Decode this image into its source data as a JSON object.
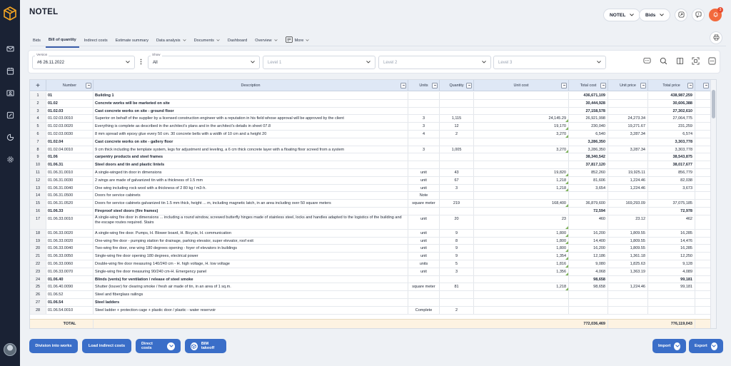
{
  "app": {
    "title": "NOTEL"
  },
  "header": {
    "project": "NOTEL",
    "mode": "Bids",
    "notifications": "3"
  },
  "tabs": [
    {
      "label": "Bids"
    },
    {
      "label": "Bill of quantity"
    },
    {
      "label": "Indirect costs"
    },
    {
      "label": "Estimate summary"
    },
    {
      "label": "Data analysis"
    },
    {
      "label": "Documents"
    },
    {
      "label": "Dashboard"
    },
    {
      "label": "Overview"
    },
    {
      "label": "More"
    }
  ],
  "filters": {
    "version_label": "Version",
    "version_value": "#6 26.11.2022",
    "show_label": "Show",
    "show_value": "All",
    "level1": "Level 1",
    "level2": "Level 2",
    "level3": "Level 3"
  },
  "table": {
    "headers": {
      "number": "Number",
      "description": "Description",
      "units": "Units",
      "quantity": "Quantity",
      "unit_cost": "Unit cost",
      "total_cost": "Total cost",
      "unit_price": "Unit price",
      "total_price": "Total price"
    },
    "rows": [
      {
        "idx": "1",
        "num": "01",
        "desc": "Building 1",
        "units": "",
        "qty": "",
        "uc": "",
        "tc": "436,671,109",
        "up": "",
        "tp": "438,987,259",
        "bold": true
      },
      {
        "idx": "2",
        "num": "01.02",
        "desc": "Concrete works will be marketed on site",
        "units": "",
        "qty": "",
        "uc": "",
        "tc": "30,444,928",
        "up": "",
        "tp": "30,606,388",
        "bold": true
      },
      {
        "idx": "3",
        "num": "01.02.03",
        "desc": "Cast concrete works on site - ground floor",
        "units": "",
        "qty": "",
        "uc": "",
        "tc": "27,158,578",
        "up": "",
        "tp": "27,302,610",
        "bold": true
      },
      {
        "idx": "4",
        "num": "01.02.03.0010",
        "desc": "Superior on behalf of the supplier by a licensed construction engineer with a reputation in his field whose approval will be approved by the client",
        "units": "3",
        "qty": "1,115",
        "uc": "24,145.29",
        "tc": "26,921,998",
        "up": "24,273.34",
        "tp": "27,064,775",
        "bold": false
      },
      {
        "idx": "5",
        "num": "01.02.03.0020",
        "desc": "Everything is complete as described in the architect's plans and in the architect's details in sheet 07.8",
        "units": "3",
        "qty": "12",
        "uc": "19,170",
        "tc": "230,040",
        "up": "19,271.67",
        "tp": "231,259",
        "bold": false
      },
      {
        "idx": "6",
        "num": "01.02.03.0030",
        "desc": "8 mm spread with epoxy glue every 50 cm. 30 concrete belts with a width of 10 cm and a height 20",
        "units": "4",
        "qty": "2",
        "uc": "3,270",
        "tc": "6,540",
        "up": "3,287.34",
        "tp": "6,574",
        "bold": false
      },
      {
        "idx": "7",
        "num": "01.02.04",
        "desc": "Cast concrete works on site - gallery floor",
        "units": "",
        "qty": "",
        "uc": "",
        "tc": "3,286,350",
        "up": "",
        "tp": "3,303,778",
        "bold": true
      },
      {
        "idx": "8",
        "num": "01.02.04.0010",
        "desc": "9 cm thick including the template system, legs for adjustment and leveling, a 6 cm thick concrete layer with a floating floor screed from a system",
        "units": "3",
        "qty": "1,005",
        "uc": "3,270",
        "tc": "3,286,350",
        "up": "3,287.34",
        "tp": "3,303,778",
        "bold": false
      },
      {
        "idx": "9",
        "num": "01.06",
        "desc": "carpentry products and steel frames",
        "units": "",
        "qty": "",
        "uc": "",
        "tc": "38,340,542",
        "up": "",
        "tp": "38,543,875",
        "bold": true
      },
      {
        "idx": "10",
        "num": "01.06.31",
        "desc": "Steel doors and tin and plastic lintels",
        "units": "",
        "qty": "",
        "uc": "",
        "tc": "37,817,120",
        "up": "",
        "tp": "38,017,677",
        "bold": true
      },
      {
        "idx": "11",
        "num": "01.06.31.0010",
        "desc": "A single-winged tin door in dimensions",
        "units": "unit",
        "qty": "43",
        "uc": "19,820",
        "tc": "852,260",
        "up": "19,925.11",
        "tp": "856,779",
        "bold": false
      },
      {
        "idx": "12",
        "num": "01.06.31.0030",
        "desc": "2 wings are made of galvanized tin with a thickness of 1.5 mm",
        "units": "unit",
        "qty": "67",
        "uc": "1,218",
        "tc": "81,606",
        "up": "1,224.46",
        "tp": "82,038",
        "bold": false
      },
      {
        "idx": "13",
        "num": "01.06.31.0040",
        "desc": "One wing including rock wool with a thickness of 2 80 kg / m3-h.",
        "units": "unit",
        "qty": "3",
        "uc": "1,218",
        "tc": "3,654",
        "up": "1,224.46",
        "tp": "3,673",
        "bold": false
      },
      {
        "idx": "14",
        "num": "01.06.31.0500",
        "desc": "Doors for service cabinets",
        "units": "Note",
        "qty": "",
        "uc": "",
        "tc": "",
        "up": "",
        "tp": "",
        "bold": false
      },
      {
        "idx": "15",
        "num": "01.06.31.0520",
        "desc": "Doors for service cabinets galvanized tin 1.5 mm thick, height ... m, including magnetic latch, in an area including over 50 square meters",
        "units": "square meter",
        "qty": "219",
        "uc": "168,400",
        "tc": "36,879,600",
        "up": "169,293.09",
        "tp": "37,075,185",
        "bold": false
      },
      {
        "idx": "16",
        "num": "01.06.33",
        "desc": "Fireproof steel doors (fire frames)",
        "units": "",
        "qty": "",
        "uc": "",
        "tc": "72,594",
        "up": "",
        "tp": "72,978",
        "bold": true
      },
      {
        "idx": "17",
        "num": "01.06.33.0010",
        "desc": "A single-wing fire door in dimensions ... including a round window, screwed butterfly hinges made of stainless steel, locks and handles adapted to the logistics of the building and the escape routes required. Stairs",
        "units": "unit",
        "qty": "20",
        "uc": "23",
        "tc": "460",
        "up": "23.12",
        "tp": "462",
        "bold": false,
        "tall": true
      },
      {
        "idx": "18",
        "num": "01.06.33.0020",
        "desc": "A single-wing fire door. Pumps, H. Blower board, H. Bicycle, H. communication",
        "units": "unit",
        "qty": "9",
        "uc": "1,800",
        "tc": "16,200",
        "up": "1,809.55",
        "tp": "16,285",
        "bold": false
      },
      {
        "idx": "19",
        "num": "01.06.33.0020",
        "desc": "One-wing fire door - pumping station for drainage, parking elevator, super elevator, roof exit",
        "units": "unit",
        "qty": "8",
        "uc": "1,800",
        "tc": "14,400",
        "up": "1,809.55",
        "tp": "14,476",
        "bold": false
      },
      {
        "idx": "20",
        "num": "01.06.33.0040",
        "desc": "Two-wing fire door, one wing 180 degrees opening - foyer of elevators in buildings",
        "units": "unit",
        "qty": "9",
        "uc": "1,800",
        "tc": "16,200",
        "up": "1,809.55",
        "tp": "16,285",
        "bold": false
      },
      {
        "idx": "21",
        "num": "01.06.33.0050",
        "desc": "Single-wing fire door opening 180 degrees, electrical power",
        "units": "unit",
        "qty": "9",
        "uc": "1,354",
        "tc": "12,186",
        "up": "1,361.18",
        "tp": "12,250",
        "bold": false
      },
      {
        "idx": "22",
        "num": "01.06.33.0060",
        "desc": "Double-wing fire door measuring 140/240 cm - H. high voltage, H. low voltage",
        "units": "units",
        "qty": "5",
        "uc": "1,816",
        "tc": "9,080",
        "up": "1,825.63",
        "tp": "9,128",
        "bold": false
      },
      {
        "idx": "23",
        "num": "01.06.33.0070",
        "desc": "Single-wing fire door measuring 90/240 cm-H. Emergency panel",
        "units": "unit",
        "qty": "3",
        "uc": "1,356",
        "tc": "4,068",
        "up": "1,363.19",
        "tp": "4,089",
        "bold": false
      },
      {
        "idx": "24",
        "num": "01.06.40",
        "desc": "Blinds (vents) for ventilation / release of steel smoke",
        "units": "",
        "qty": "",
        "uc": "",
        "tc": "98,658",
        "up": "",
        "tp": "99,181",
        "bold": true
      },
      {
        "idx": "25",
        "num": "01.06.40.0090",
        "desc": "Shutter (louver) for clearing smoke / fresh air made of tin, in an area of 1 sq.m.",
        "units": "square meter",
        "qty": "81",
        "uc": "1,218",
        "tc": "98,658",
        "up": "1,224.46",
        "tp": "99,181",
        "bold": false
      },
      {
        "idx": "26",
        "num": "01.06.52",
        "desc": "Steel and fiberglass railings",
        "units": "",
        "qty": "",
        "uc": "",
        "tc": "",
        "up": "",
        "tp": "",
        "bold": false
      },
      {
        "idx": "27",
        "num": "01.06.54",
        "desc": "Steel ladders",
        "units": "",
        "qty": "",
        "uc": "",
        "tc": "",
        "up": "",
        "tp": "",
        "bold": true
      },
      {
        "idx": "28",
        "num": "01.06.54.0010",
        "desc": "Steel ladder + protection cage + plastic door / plastic - water reservoir",
        "units": "Complete",
        "qty": "2",
        "uc": "",
        "tc": "",
        "up": "",
        "tp": "",
        "bold": false
      }
    ],
    "total": {
      "label": "TOTAL",
      "tc": "772,036,469",
      "tp": "776,119,043"
    }
  },
  "footer": {
    "division": "Division into works",
    "indirect": "Load indirect costs",
    "direct": "Direct costs",
    "bim": "BIM takeoff",
    "import": "Import",
    "export": "Export"
  },
  "colors": {
    "accent": "#3a6ec8",
    "sidebar": "#1a2234",
    "header_row": "#dfe8f6",
    "total_row": "#fdf3e2"
  }
}
